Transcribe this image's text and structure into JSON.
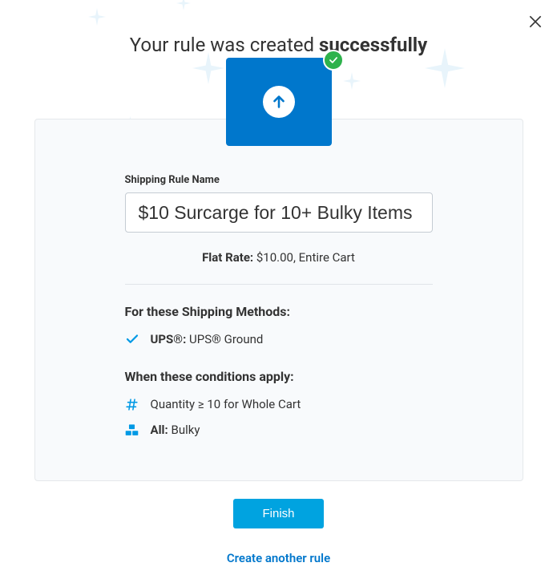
{
  "title": {
    "prefix": "Your rule was created ",
    "strong": "successfully"
  },
  "form": {
    "name_label": "Shipping Rule Name",
    "name_value": "$10 Surcarge for 10+ Bulky Items"
  },
  "rate": {
    "label": "Flat Rate:",
    "value": " $10.00, Entire Cart"
  },
  "methods": {
    "heading": "For these Shipping Methods:",
    "items": [
      {
        "bold": "UPS®:",
        "text": " UPS® Ground"
      }
    ]
  },
  "conditions": {
    "heading": "When these conditions apply:",
    "items": [
      {
        "icon": "hash",
        "bold": "",
        "text": "Quantity ≥ 10 for Whole Cart"
      },
      {
        "icon": "boxes",
        "bold": "All:",
        "text": " Bulky"
      }
    ]
  },
  "footer": {
    "finish": "Finish",
    "link": "Create another rule"
  }
}
